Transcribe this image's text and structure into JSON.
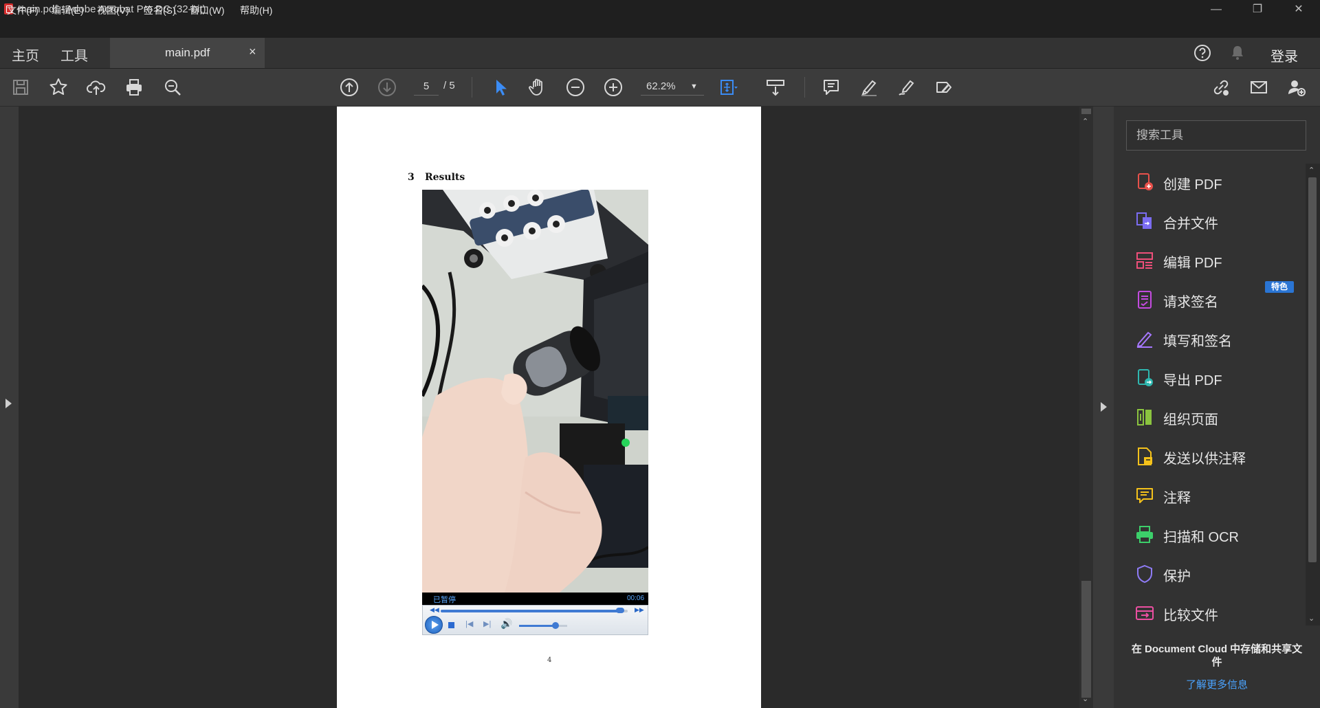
{
  "window": {
    "title": "main.pdf - Adobe Acrobat Pro DC (32-bit)",
    "controls": [
      "minimize",
      "restore",
      "close"
    ]
  },
  "menu": [
    "文件(F)",
    "编辑(E)",
    "视图(V)",
    "签名(S)",
    "窗口(W)",
    "帮助(H)"
  ],
  "tabs": {
    "home": "主页",
    "tools": "工具",
    "document": "main.pdf",
    "close_glyph": "×",
    "login": "登录"
  },
  "toolbar": {
    "current_page": "5",
    "total_pages": "/ 5",
    "zoom": "62.2%"
  },
  "document": {
    "section_number": "3",
    "section_title": "Results",
    "page_number": "4",
    "video": {
      "status": "已暂停",
      "time": "00:06",
      "progress": 0.96,
      "volume": 0.75
    }
  },
  "tools_panel": {
    "search_placeholder": "搜索工具",
    "featured_badge": "特色",
    "items": [
      {
        "label": "创建 PDF",
        "icon": "create-pdf-icon",
        "color": "#e8514b"
      },
      {
        "label": "合并文件",
        "icon": "combine-files-icon",
        "color": "#7b6cf2"
      },
      {
        "label": "编辑 PDF",
        "icon": "edit-pdf-icon",
        "color": "#ef4f7a"
      },
      {
        "label": "请求签名",
        "icon": "request-signature-icon",
        "color": "#c44be0"
      },
      {
        "label": "填写和签名",
        "icon": "fill-sign-icon",
        "color": "#a678ff"
      },
      {
        "label": "导出 PDF",
        "icon": "export-pdf-icon",
        "color": "#2fb8b0"
      },
      {
        "label": "组织页面",
        "icon": "organize-pages-icon",
        "color": "#8bc43f"
      },
      {
        "label": "发送以供注释",
        "icon": "send-comments-icon",
        "color": "#f5c21b"
      },
      {
        "label": "注释",
        "icon": "comment-icon",
        "color": "#f5c21b"
      },
      {
        "label": "扫描和 OCR",
        "icon": "scan-ocr-icon",
        "color": "#3ccf6a"
      },
      {
        "label": "保护",
        "icon": "protect-icon",
        "color": "#8f7cf7"
      },
      {
        "label": "比较文件",
        "icon": "compare-files-icon",
        "color": "#ec4fa2"
      }
    ],
    "cloud_promo": "在 Document Cloud 中存储和共享文件",
    "learn_more": "了解更多信息"
  },
  "colors": {
    "accent_blue": "#2a75d4",
    "link_blue": "#4aa3ff",
    "select_tool_blue": "#3b8cf5"
  }
}
